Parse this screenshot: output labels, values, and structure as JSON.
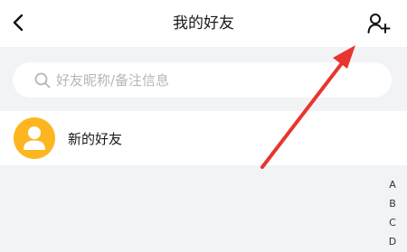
{
  "header": {
    "back_icon": "chevron-left-icon",
    "title": "我的好友",
    "add_friend_icon": "add-user-icon"
  },
  "search": {
    "icon": "search-icon",
    "placeholder": "好友昵称/备注信息"
  },
  "new_friends": {
    "avatar_icon": "user-silhouette-icon",
    "avatar_color": "#fdb61f",
    "label": "新的好友"
  },
  "index_bar": {
    "letters": [
      "A",
      "B",
      "C",
      "D"
    ]
  },
  "annotation": {
    "arrow_color": "#e8352f"
  }
}
